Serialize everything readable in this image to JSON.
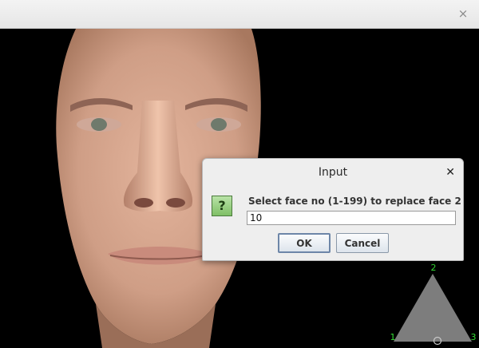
{
  "window": {
    "close_glyph": "×"
  },
  "viewport": {
    "triangle": {
      "vertex_labels": [
        "2",
        "1",
        "3"
      ],
      "label_color": "#33dd33",
      "fill": "#7d7d7d"
    }
  },
  "dialog": {
    "title": "Input",
    "close_glyph": "✕",
    "icon": "question-icon",
    "icon_glyph": "?",
    "message": "Select face no (1-199) to replace face 2",
    "input_value": "10",
    "ok_label": "OK",
    "cancel_label": "Cancel"
  }
}
